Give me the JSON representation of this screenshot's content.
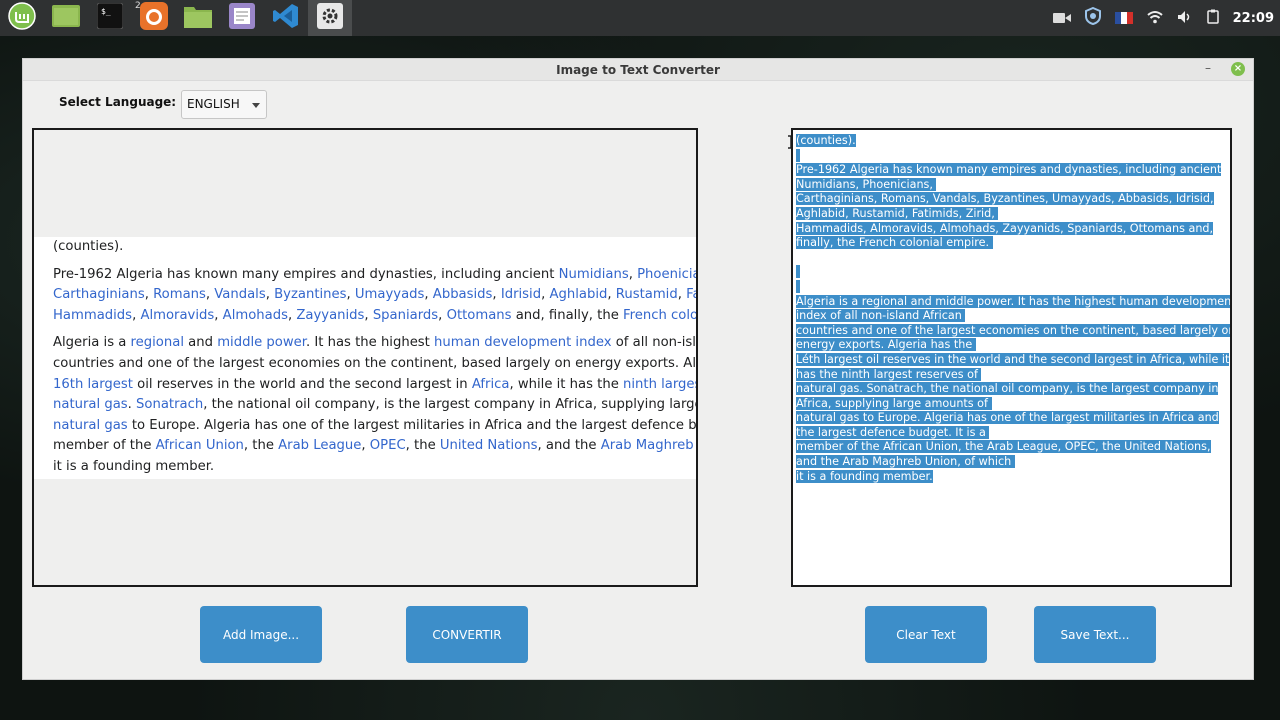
{
  "panel": {
    "launchers": [
      {
        "name": "mint-menu-icon",
        "color": "#7fbf4d"
      },
      {
        "name": "desktop-icon",
        "color": "#8bb64e"
      },
      {
        "name": "terminal-icon",
        "color": "#111111"
      },
      {
        "name": "firefox-icon",
        "color": "#e8722a",
        "badge": "2"
      },
      {
        "name": "files-icon",
        "color": "#8bb64e"
      },
      {
        "name": "text-editor-icon",
        "color": "#9a86c9"
      },
      {
        "name": "vscode-icon",
        "color": "#2f8ad1"
      },
      {
        "name": "settings-icon",
        "color": "#cfcfcf"
      }
    ],
    "clock": "22:09"
  },
  "window": {
    "title": "Image to Text Converter",
    "language_label": "Select Language:",
    "language_value": "ENGLISH",
    "buttons": {
      "add_image": "Add Image...",
      "convert": "CONVERTIR",
      "clear": "Clear Text",
      "save": "Save Text..."
    }
  },
  "image_content": {
    "p1": [
      "(counties)."
    ],
    "p2_l1": [
      {
        "t": "Pre-1962 Algeria has known many empires and dynasties, including ancient "
      },
      {
        "t": "Numidians",
        "link": true
      },
      {
        "t": ", "
      },
      {
        "t": "Phoenicians",
        "link": true
      },
      {
        "t": ","
      }
    ],
    "p2_l2": [
      {
        "t": "Carthaginians",
        "link": true
      },
      {
        "t": ", "
      },
      {
        "t": "Romans",
        "link": true
      },
      {
        "t": ", "
      },
      {
        "t": "Vandals",
        "link": true
      },
      {
        "t": ", "
      },
      {
        "t": "Byzantines",
        "link": true
      },
      {
        "t": ", "
      },
      {
        "t": "Umayyads",
        "link": true
      },
      {
        "t": ", "
      },
      {
        "t": "Abbasids",
        "link": true
      },
      {
        "t": ", "
      },
      {
        "t": "Idrisid",
        "link": true
      },
      {
        "t": ", "
      },
      {
        "t": "Aghlabid",
        "link": true
      },
      {
        "t": ", "
      },
      {
        "t": "Rustamid",
        "link": true
      },
      {
        "t": ", "
      },
      {
        "t": "Fatimids",
        "link": true
      }
    ],
    "p2_l3": [
      {
        "t": "Hammadids",
        "link": true
      },
      {
        "t": ", "
      },
      {
        "t": "Almoravids",
        "link": true
      },
      {
        "t": ", "
      },
      {
        "t": "Almohads",
        "link": true
      },
      {
        "t": ", "
      },
      {
        "t": "Zayyanids",
        "link": true
      },
      {
        "t": ", "
      },
      {
        "t": "Spaniards",
        "link": true
      },
      {
        "t": ", "
      },
      {
        "t": "Ottomans",
        "link": true
      },
      {
        "t": " and, finally, the "
      },
      {
        "t": "French colonial empire",
        "link": true
      }
    ],
    "p3_l1": [
      {
        "t": "Algeria is a "
      },
      {
        "t": "regional",
        "link": true
      },
      {
        "t": " and "
      },
      {
        "t": "middle power",
        "link": true
      },
      {
        "t": ". It has the highest "
      },
      {
        "t": "human development index",
        "link": true
      },
      {
        "t": " of all non-island African"
      }
    ],
    "p3_l2": [
      {
        "t": "countries and one of the largest economies on the continent, based largely on energy exports. Algeria has the"
      }
    ],
    "p3_l3": [
      {
        "t": "16th largest",
        "link": true
      },
      {
        "t": " oil reserves in the world and the second largest in "
      },
      {
        "t": "Africa",
        "link": true
      },
      {
        "t": ", while it has the "
      },
      {
        "t": "ninth largest",
        "link": true
      },
      {
        "t": " reserves of"
      }
    ],
    "p3_l4": [
      {
        "t": "natural gas",
        "link": true
      },
      {
        "t": ". "
      },
      {
        "t": "Sonatrach",
        "link": true
      },
      {
        "t": ", the national oil company, is the largest company in Africa, supplying large amounts of"
      }
    ],
    "p3_l5": [
      {
        "t": "natural gas",
        "link": true
      },
      {
        "t": " to Europe. Algeria has one of the largest militaries in Africa and the largest defence budget. It is a"
      }
    ],
    "p3_l6": [
      {
        "t": "member of the "
      },
      {
        "t": "African Union",
        "link": true
      },
      {
        "t": ", the "
      },
      {
        "t": "Arab League",
        "link": true
      },
      {
        "t": ", "
      },
      {
        "t": "OPEC",
        "link": true
      },
      {
        "t": ", the "
      },
      {
        "t": "United Nations",
        "link": true
      },
      {
        "t": ", and the "
      },
      {
        "t": "Arab Maghreb Union",
        "link": true
      },
      {
        "t": ", of which"
      }
    ],
    "p3_l7": [
      {
        "t": "it is a founding member."
      }
    ]
  },
  "output_text": {
    "lines": [
      "(counties).",
      " ",
      "Pre-1962 Algeria has known many empires and dynasties, including ancient",
      "Numidians, Phoenicians, ",
      "Carthaginians, Romans, Vandals, Byzantines, Umayyads, Abbasids, Idrisid,",
      "Aghlabid, Rustamid, Fatimids, Zirid, ",
      "Hammadids, Almoravids, Almohads, Zayyanids, Spaniards, Ottomans and,",
      "finally, the French colonial empire. ",
      "",
      " ",
      " ",
      "Algeria is a regional and middle power. It has the highest human development",
      "index of all non-island African ",
      "countries and one of the largest economies on the continent, based largely on",
      "energy exports. Algeria has the ",
      "Léth largest oil reserves in the world and the second largest in Africa, while it",
      "has the ninth largest reserves of ",
      "natural gas. Sonatrach, the national oil company, is the largest company in",
      "Africa, supplying large amounts of ",
      "natural gas to Europe. Algeria has one of the largest militaries in Africa and",
      "the largest defence budget. It is a ",
      "member of the African Union, the Arab League, OPEC, the United Nations,",
      "and the Arab Maghreb Union, of which ",
      "it is a founding member."
    ]
  }
}
